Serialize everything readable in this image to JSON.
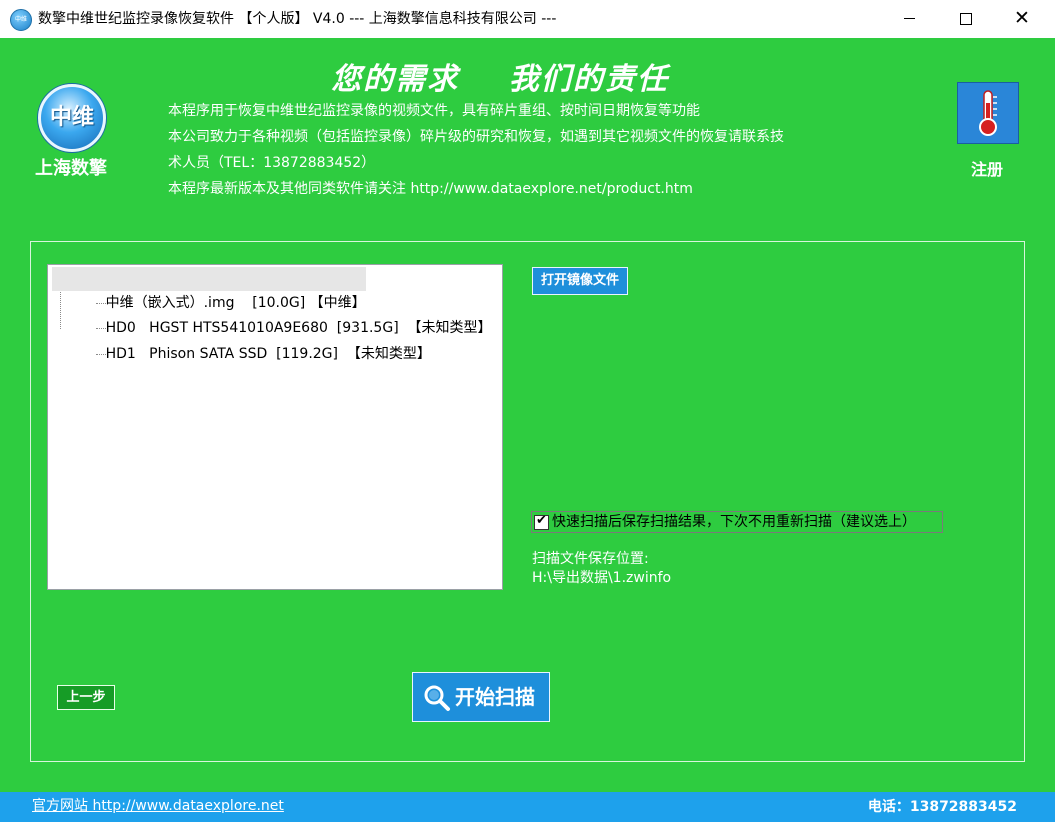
{
  "window": {
    "title": "数擎中维世纪监控录像恢复软件 【个人版】 V4.0 --- 上海数擎信息科技有限公司 ---",
    "app_icon_text": "中维",
    "minimize_glyph": "—",
    "maximize_glyph": "☐",
    "close_glyph": "✕"
  },
  "header": {
    "logo_text": "中维",
    "company": "上海数擎",
    "slogan": "您的需求    我们的责任",
    "desc_lines": [
      "本程序用于恢复中维世纪监控录像的视频文件，具有碎片重组、按时间日期恢复等功能",
      "本公司致力于各种视频（包括监控录像）碎片级的研究和恢复，如遇到其它视频文件的恢复请联系技",
      "术人员（TEL：13872883452）",
      "本程序最新版本及其他同类软件请关注 http://www.dataexplore.net/product.htm"
    ],
    "register_label": "注册"
  },
  "main": {
    "tree_items": [
      "中维（嵌入式）.img    [10.0G] 【中维】",
      "HD0   HGST HTS541010A9E680  [931.5G]  【未知类型】",
      "HD1   Phison SATA SSD  [119.2G]  【未知类型】"
    ],
    "open_image_button": "打开镜像文件",
    "quick_scan_checkbox": {
      "checked": true,
      "label": "快速扫描后保存扫描结果，下次不用重新扫描（建议选上）"
    },
    "save_location_label": "扫描文件保存位置:",
    "save_location_path": "H:\\导出数据\\1.zwinfo",
    "prev_button": "上一步",
    "start_scan_button": "开始扫描"
  },
  "footer": {
    "website": "官方网站 http://www.dataexplore.net",
    "phone": "电话：13872883452"
  },
  "colors": {
    "background": "#2ecc40",
    "accent_blue": "#1e8fdb",
    "footer_blue": "#1ea1ec",
    "prev_button_green": "#169c26"
  }
}
